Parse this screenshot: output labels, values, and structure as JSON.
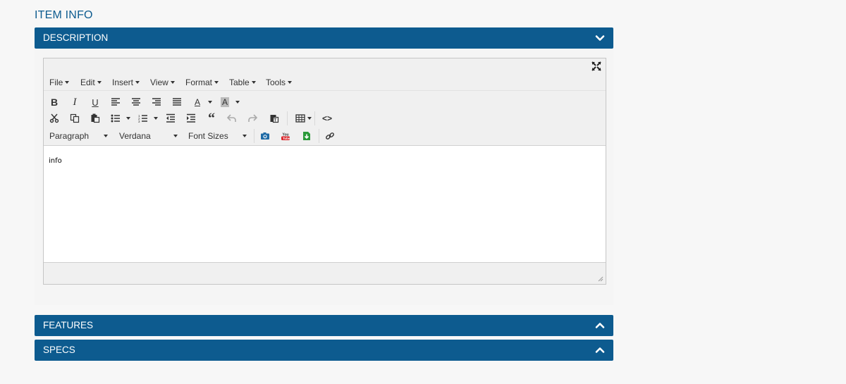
{
  "page": {
    "section_title": "ITEM INFO"
  },
  "panels": [
    {
      "title": "DESCRIPTION",
      "expanded": true
    },
    {
      "title": "FEATURES",
      "expanded": false
    },
    {
      "title": "SPECS",
      "expanded": false
    }
  ],
  "editor": {
    "menu": [
      "File",
      "Edit",
      "Insert",
      "View",
      "Format",
      "Table",
      "Tools"
    ],
    "block_format": "Paragraph",
    "font_family": "Verdana",
    "font_size": "Font Sizes",
    "content_text": "info",
    "toolbar_icons_row1": [
      "bold-icon",
      "italic-icon",
      "underline-icon",
      "align-left-icon",
      "align-center-icon",
      "align-right-icon",
      "align-justify-icon",
      "text-color-icon",
      "background-color-icon"
    ],
    "toolbar_icons_row2": [
      "cut-icon",
      "copy-icon",
      "paste-icon",
      "bullet-list-icon",
      "numbered-list-icon",
      "outdent-icon",
      "indent-icon",
      "blockquote-icon",
      "undo-icon",
      "redo-icon",
      "paste-text-icon",
      "table-icon",
      "source-code-icon"
    ],
    "toolbar_icons_row3": [
      "image-icon",
      "youtube-icon",
      "insert-file-icon",
      "link-icon"
    ],
    "colors": {
      "panel_header": "#0d5b8f",
      "title": "#0d5b8f"
    }
  }
}
